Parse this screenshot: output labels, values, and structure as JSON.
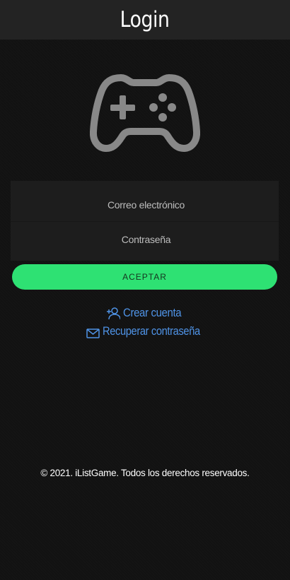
{
  "header": {
    "title": "Login"
  },
  "logo": {
    "icon": "gamepad-icon",
    "color": "#888888"
  },
  "form": {
    "email_placeholder": "Correo electrónico",
    "password_placeholder": "Contraseña",
    "submit_label": "ACEPTAR"
  },
  "links": {
    "create_account": {
      "icon": "user-plus-icon",
      "label": "Crear cuenta"
    },
    "recover_password": {
      "icon": "envelope-icon",
      "label": "Recuperar contraseña"
    }
  },
  "footer": {
    "text": "© 2021. iListGame. Todos los derechos reservados."
  },
  "colors": {
    "background": "#121212",
    "header": "#232323",
    "accent": "#2ee173",
    "link": "#4f93e6"
  }
}
